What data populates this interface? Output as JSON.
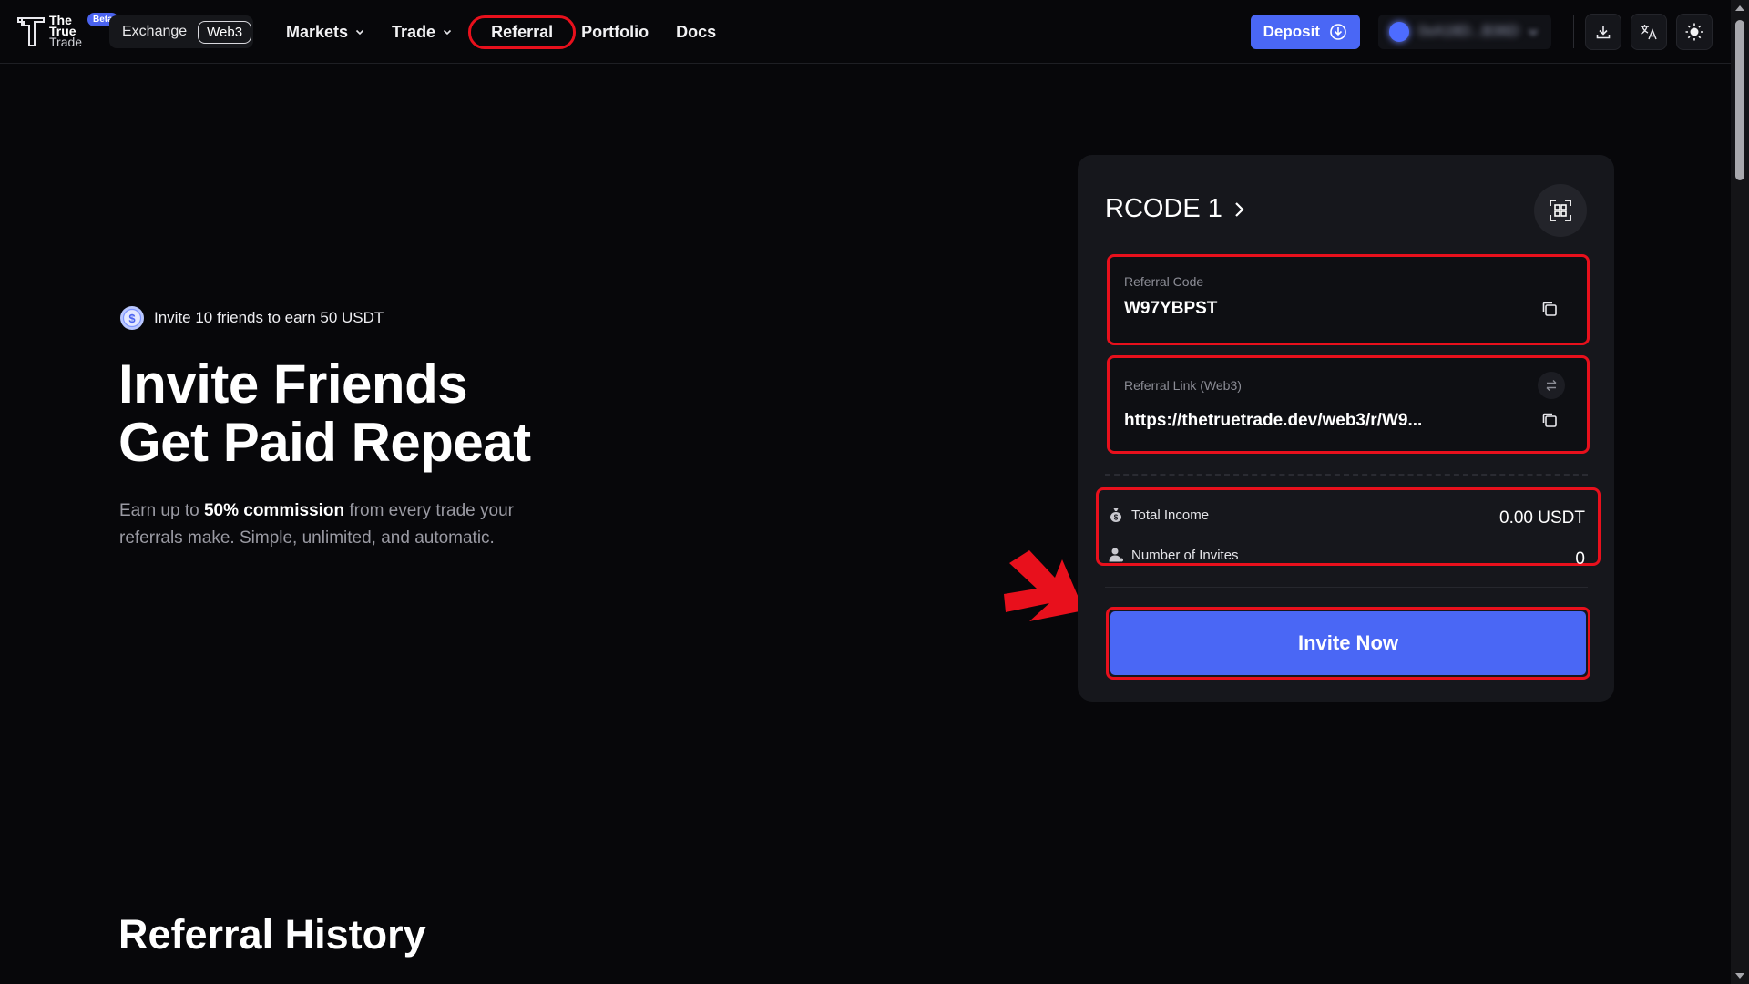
{
  "header": {
    "logo": {
      "line1": "The",
      "line2": "True",
      "line3": "Trade",
      "badge": "Beta"
    },
    "mode_toggle": {
      "exchange": "Exchange",
      "web3": "Web3"
    },
    "nav": [
      {
        "label": "Markets",
        "has_dropdown": true
      },
      {
        "label": "Trade",
        "has_dropdown": true
      },
      {
        "label": "Referral",
        "has_dropdown": false,
        "active": true
      },
      {
        "label": "Portfolio",
        "has_dropdown": false
      },
      {
        "label": "Docs",
        "has_dropdown": false
      }
    ],
    "deposit_label": "Deposit",
    "wallet_address": "0xA18D...B36D",
    "icons": [
      "download-icon",
      "translate-icon",
      "sun-icon"
    ]
  },
  "hero": {
    "promo": "Invite 10 friends to earn 50 USDT",
    "title_line1": "Invite Friends",
    "title_line2": "Get Paid Repeat",
    "desc_pre": "Earn up to ",
    "desc_highlight": "50% commission",
    "desc_post": " from every trade your referrals make. Simple, unlimited, and automatic."
  },
  "card": {
    "code_name": "RCODE 1",
    "referral_code_label": "Referral Code",
    "referral_code": "W97YBPST",
    "referral_link_label": "Referral Link (Web3)",
    "referral_link": "https://thetruetrade.dev/web3/r/W9...",
    "total_income_label": "Total Income",
    "total_income": "0.00 USDT",
    "invites_label": "Number of Invites",
    "invites": "0",
    "invite_button": "Invite Now"
  },
  "history": {
    "title": "Referral History"
  },
  "colors": {
    "background": "#07070a",
    "accent": "#4a67f5",
    "highlight": "#e8101c",
    "card": "#16171c"
  }
}
